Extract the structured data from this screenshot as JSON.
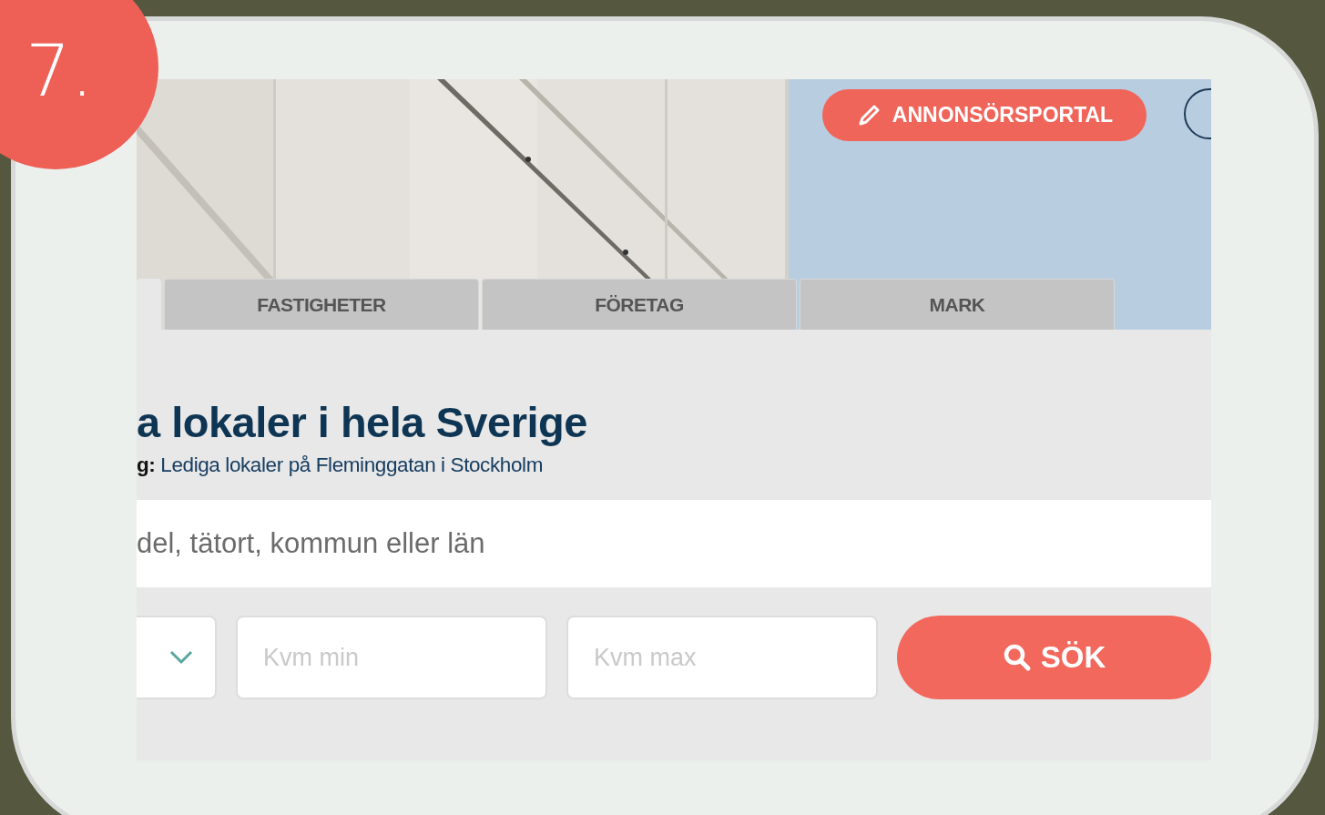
{
  "badge": {
    "label": "7."
  },
  "header": {
    "portal_button": "ANNONSÖRSPORTAL"
  },
  "tabs": [
    {
      "selected": true
    },
    {
      "label": "FASTIGHETER",
      "selected": false
    },
    {
      "label": "FÖRETAG",
      "selected": false
    },
    {
      "label": "MARK",
      "selected": false
    }
  ],
  "heading": "a lokaler i hela Sverige",
  "subtitle": "**g:** Lediga lokaler på Fleminggatan i Stockholm",
  "search": {
    "placeholder": "del, tätort, kommun eller län"
  },
  "filters": [
    {
      "kind": "dropdown"
    },
    {
      "kind": "input",
      "placeholder": "Kvm min"
    },
    {
      "kind": "input",
      "placeholder": "Kvm max"
    }
  ],
  "search_button": "SÖK"
}
